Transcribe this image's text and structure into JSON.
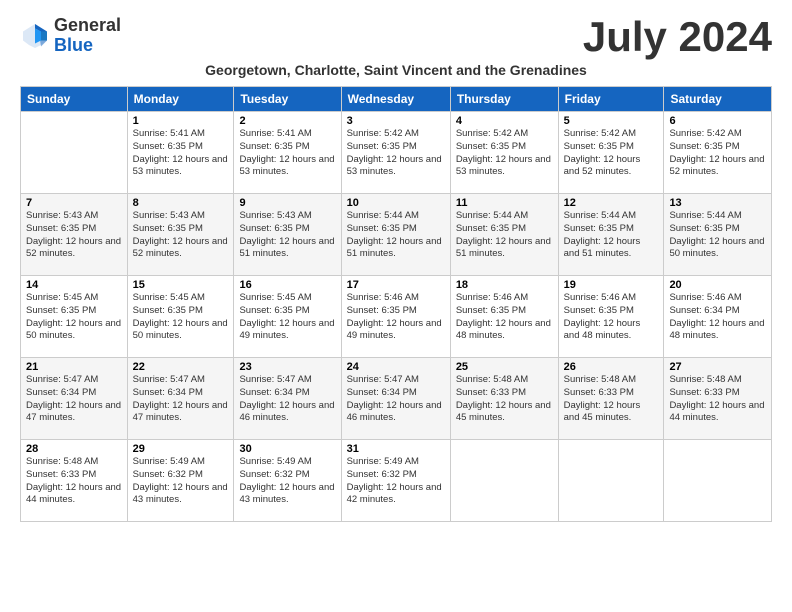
{
  "header": {
    "logo_general": "General",
    "logo_blue": "Blue",
    "month_title": "July 2024",
    "subtitle": "Georgetown, Charlotte, Saint Vincent and the Grenadines"
  },
  "days_of_week": [
    "Sunday",
    "Monday",
    "Tuesday",
    "Wednesday",
    "Thursday",
    "Friday",
    "Saturday"
  ],
  "weeks": [
    [
      {
        "day": "",
        "sunrise": "",
        "sunset": "",
        "daylight": ""
      },
      {
        "day": "1",
        "sunrise": "Sunrise: 5:41 AM",
        "sunset": "Sunset: 6:35 PM",
        "daylight": "Daylight: 12 hours and 53 minutes."
      },
      {
        "day": "2",
        "sunrise": "Sunrise: 5:41 AM",
        "sunset": "Sunset: 6:35 PM",
        "daylight": "Daylight: 12 hours and 53 minutes."
      },
      {
        "day": "3",
        "sunrise": "Sunrise: 5:42 AM",
        "sunset": "Sunset: 6:35 PM",
        "daylight": "Daylight: 12 hours and 53 minutes."
      },
      {
        "day": "4",
        "sunrise": "Sunrise: 5:42 AM",
        "sunset": "Sunset: 6:35 PM",
        "daylight": "Daylight: 12 hours and 53 minutes."
      },
      {
        "day": "5",
        "sunrise": "Sunrise: 5:42 AM",
        "sunset": "Sunset: 6:35 PM",
        "daylight": "Daylight: 12 hours and 52 minutes."
      },
      {
        "day": "6",
        "sunrise": "Sunrise: 5:42 AM",
        "sunset": "Sunset: 6:35 PM",
        "daylight": "Daylight: 12 hours and 52 minutes."
      }
    ],
    [
      {
        "day": "7",
        "sunrise": "Sunrise: 5:43 AM",
        "sunset": "Sunset: 6:35 PM",
        "daylight": "Daylight: 12 hours and 52 minutes."
      },
      {
        "day": "8",
        "sunrise": "Sunrise: 5:43 AM",
        "sunset": "Sunset: 6:35 PM",
        "daylight": "Daylight: 12 hours and 52 minutes."
      },
      {
        "day": "9",
        "sunrise": "Sunrise: 5:43 AM",
        "sunset": "Sunset: 6:35 PM",
        "daylight": "Daylight: 12 hours and 51 minutes."
      },
      {
        "day": "10",
        "sunrise": "Sunrise: 5:44 AM",
        "sunset": "Sunset: 6:35 PM",
        "daylight": "Daylight: 12 hours and 51 minutes."
      },
      {
        "day": "11",
        "sunrise": "Sunrise: 5:44 AM",
        "sunset": "Sunset: 6:35 PM",
        "daylight": "Daylight: 12 hours and 51 minutes."
      },
      {
        "day": "12",
        "sunrise": "Sunrise: 5:44 AM",
        "sunset": "Sunset: 6:35 PM",
        "daylight": "Daylight: 12 hours and 51 minutes."
      },
      {
        "day": "13",
        "sunrise": "Sunrise: 5:44 AM",
        "sunset": "Sunset: 6:35 PM",
        "daylight": "Daylight: 12 hours and 50 minutes."
      }
    ],
    [
      {
        "day": "14",
        "sunrise": "Sunrise: 5:45 AM",
        "sunset": "Sunset: 6:35 PM",
        "daylight": "Daylight: 12 hours and 50 minutes."
      },
      {
        "day": "15",
        "sunrise": "Sunrise: 5:45 AM",
        "sunset": "Sunset: 6:35 PM",
        "daylight": "Daylight: 12 hours and 50 minutes."
      },
      {
        "day": "16",
        "sunrise": "Sunrise: 5:45 AM",
        "sunset": "Sunset: 6:35 PM",
        "daylight": "Daylight: 12 hours and 49 minutes."
      },
      {
        "day": "17",
        "sunrise": "Sunrise: 5:46 AM",
        "sunset": "Sunset: 6:35 PM",
        "daylight": "Daylight: 12 hours and 49 minutes."
      },
      {
        "day": "18",
        "sunrise": "Sunrise: 5:46 AM",
        "sunset": "Sunset: 6:35 PM",
        "daylight": "Daylight: 12 hours and 48 minutes."
      },
      {
        "day": "19",
        "sunrise": "Sunrise: 5:46 AM",
        "sunset": "Sunset: 6:35 PM",
        "daylight": "Daylight: 12 hours and 48 minutes."
      },
      {
        "day": "20",
        "sunrise": "Sunrise: 5:46 AM",
        "sunset": "Sunset: 6:34 PM",
        "daylight": "Daylight: 12 hours and 48 minutes."
      }
    ],
    [
      {
        "day": "21",
        "sunrise": "Sunrise: 5:47 AM",
        "sunset": "Sunset: 6:34 PM",
        "daylight": "Daylight: 12 hours and 47 minutes."
      },
      {
        "day": "22",
        "sunrise": "Sunrise: 5:47 AM",
        "sunset": "Sunset: 6:34 PM",
        "daylight": "Daylight: 12 hours and 47 minutes."
      },
      {
        "day": "23",
        "sunrise": "Sunrise: 5:47 AM",
        "sunset": "Sunset: 6:34 PM",
        "daylight": "Daylight: 12 hours and 46 minutes."
      },
      {
        "day": "24",
        "sunrise": "Sunrise: 5:47 AM",
        "sunset": "Sunset: 6:34 PM",
        "daylight": "Daylight: 12 hours and 46 minutes."
      },
      {
        "day": "25",
        "sunrise": "Sunrise: 5:48 AM",
        "sunset": "Sunset: 6:33 PM",
        "daylight": "Daylight: 12 hours and 45 minutes."
      },
      {
        "day": "26",
        "sunrise": "Sunrise: 5:48 AM",
        "sunset": "Sunset: 6:33 PM",
        "daylight": "Daylight: 12 hours and 45 minutes."
      },
      {
        "day": "27",
        "sunrise": "Sunrise: 5:48 AM",
        "sunset": "Sunset: 6:33 PM",
        "daylight": "Daylight: 12 hours and 44 minutes."
      }
    ],
    [
      {
        "day": "28",
        "sunrise": "Sunrise: 5:48 AM",
        "sunset": "Sunset: 6:33 PM",
        "daylight": "Daylight: 12 hours and 44 minutes."
      },
      {
        "day": "29",
        "sunrise": "Sunrise: 5:49 AM",
        "sunset": "Sunset: 6:32 PM",
        "daylight": "Daylight: 12 hours and 43 minutes."
      },
      {
        "day": "30",
        "sunrise": "Sunrise: 5:49 AM",
        "sunset": "Sunset: 6:32 PM",
        "daylight": "Daylight: 12 hours and 43 minutes."
      },
      {
        "day": "31",
        "sunrise": "Sunrise: 5:49 AM",
        "sunset": "Sunset: 6:32 PM",
        "daylight": "Daylight: 12 hours and 42 minutes."
      },
      {
        "day": "",
        "sunrise": "",
        "sunset": "",
        "daylight": ""
      },
      {
        "day": "",
        "sunrise": "",
        "sunset": "",
        "daylight": ""
      },
      {
        "day": "",
        "sunrise": "",
        "sunset": "",
        "daylight": ""
      }
    ]
  ]
}
